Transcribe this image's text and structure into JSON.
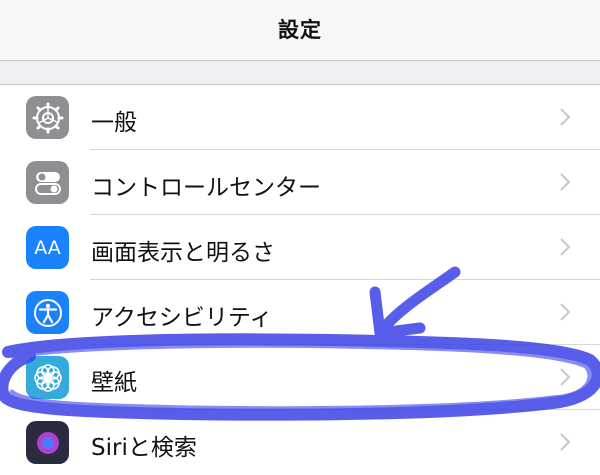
{
  "navbar": {
    "title": "設定"
  },
  "settings": {
    "rows": [
      {
        "label": "一般",
        "icon": "gear-icon",
        "icon_color": "#8e8e93"
      },
      {
        "label": "コントロールセンター",
        "icon": "toggle-switches-icon",
        "icon_color": "#8e8e93"
      },
      {
        "label": "画面表示と明るさ",
        "icon": "text-size-icon",
        "icon_text": "AA",
        "icon_color": "#1a82fb"
      },
      {
        "label": "アクセシビリティ",
        "icon": "accessibility-icon",
        "icon_color": "#1a82fb"
      },
      {
        "label": "壁紙",
        "icon": "wallpaper-flower-icon",
        "icon_color": "#35aadc"
      },
      {
        "label": "Siriと検索",
        "icon": "siri-icon",
        "icon_color": "#2b2b40"
      }
    ]
  },
  "annotation": {
    "color": "#3b42e6"
  }
}
